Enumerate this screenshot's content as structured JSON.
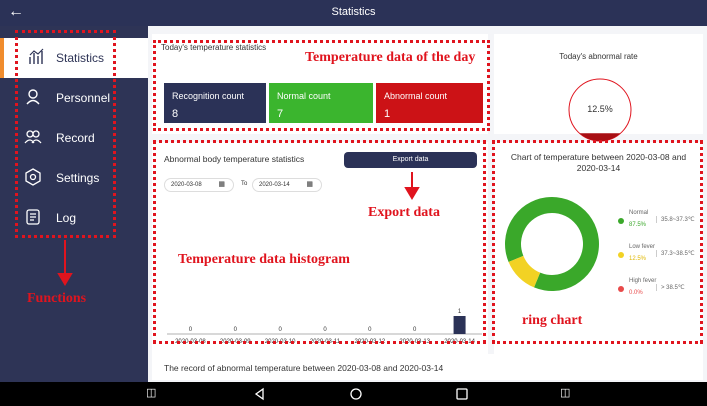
{
  "header": {
    "title": "Statistics",
    "back_icon": "arrow-left-icon"
  },
  "sidebar": {
    "items": [
      {
        "label": "Statistics",
        "icon": "chart-icon",
        "active": true
      },
      {
        "label": "Personnel",
        "icon": "person-icon",
        "active": false
      },
      {
        "label": "Record",
        "icon": "group-icon",
        "active": false
      },
      {
        "label": "Settings",
        "icon": "gear-icon",
        "active": false
      },
      {
        "label": "Log",
        "icon": "log-icon",
        "active": false
      }
    ]
  },
  "today": {
    "title": "Today's temperature statistics",
    "recognition": {
      "label": "Recognition count",
      "value": "8",
      "color": "#2b3257"
    },
    "normal": {
      "label": "Normal count",
      "value": "7",
      "color": "#3bb52e"
    },
    "abnormal": {
      "label": "Abnormal count",
      "value": "1",
      "color": "#cc1216"
    }
  },
  "abnormal_rate": {
    "title": "Today's abnormal rate",
    "value": "12.5%",
    "fraction": 0.125
  },
  "histogram": {
    "title": "Abnormal body temperature statistics",
    "export_label": "Export data",
    "date_from": "2020-03-08",
    "date_to_label": "To",
    "date_to": "2020-03-14"
  },
  "ring": {
    "title": "Chart of temperature between 2020-03-08 and 2020-03-14",
    "legend": [
      {
        "name": "Normal",
        "pct": "87.5%",
        "range": "35.8~37.3℃",
        "color": "#3aa82a"
      },
      {
        "name": "Low fever",
        "pct": "12.5%",
        "range": "37.3~38.5℃",
        "color": "#f2d224"
      },
      {
        "name": "High fever",
        "pct": "0.0%",
        "range": "> 38.5℃",
        "color": "#e84a4a"
      }
    ]
  },
  "record_title": "The record of abnormal temperature between 2020-03-08 and 2020-03-14",
  "annotations": {
    "temp_day": "Temperature data of the day",
    "export": "Export data",
    "histogram": "Temperature data histogram",
    "functions": "Functions",
    "ring": "ring chart"
  },
  "chart_data": [
    {
      "type": "bar",
      "categories": [
        "2020-03-08",
        "2020-03-09",
        "2020-03-10",
        "2020-03-11",
        "2020-03-12",
        "2020-03-13",
        "2020-03-14"
      ],
      "values": [
        0,
        0,
        0,
        0,
        0,
        0,
        1
      ],
      "color": "#2b3257"
    },
    {
      "type": "pie",
      "labels": [
        "Normal",
        "Low fever",
        "High fever"
      ],
      "values": [
        87.5,
        12.5,
        0.0
      ],
      "colors": [
        "#3aa82a",
        "#f2d224",
        "#e84a4a"
      ]
    }
  ]
}
